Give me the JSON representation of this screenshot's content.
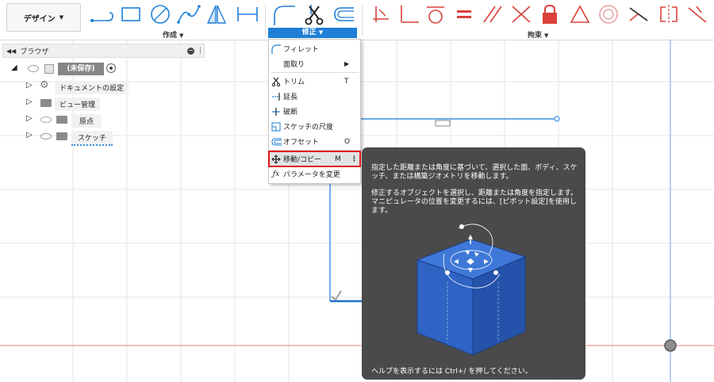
{
  "toolbar": {
    "design_label": "デザイン",
    "create_label": "作成",
    "modify_label": "修正",
    "constraints_label": "拘束"
  },
  "browser": {
    "title": "ブラウザ",
    "root_label": "(未保存)",
    "items": [
      {
        "label": "ドキュメントの設定"
      },
      {
        "label": "ビュー管理"
      },
      {
        "label": "原点"
      },
      {
        "label": "スケッチ"
      }
    ]
  },
  "modify_menu": {
    "items": [
      {
        "label": "フィレット",
        "shortcut": ""
      },
      {
        "label": "面取り",
        "shortcut": ""
      },
      {
        "label": "トリム",
        "shortcut": "T"
      },
      {
        "label": "延長",
        "shortcut": ""
      },
      {
        "label": "破断",
        "shortcut": ""
      },
      {
        "label": "スケッチの尺度",
        "shortcut": ""
      },
      {
        "label": "オフセット",
        "shortcut": "O"
      },
      {
        "label": "移動/コピー",
        "shortcut": "M"
      },
      {
        "label": "パラメータを変更",
        "shortcut": ""
      }
    ]
  },
  "tooltip": {
    "desc1": "指定した距離または角度に基づいて、選択した面、ボディ、スケッチ、または構築ジオメトリを移動します。",
    "desc2": "修正するオブジェクトを選択し、距離または角度を指定します。マニピュレータの位置を変更するには、[ピボット設定]を使用します。",
    "help_prefix": "ヘルプを表示するには ",
    "help_key": "Ctrl+/",
    "help_suffix": " を押してください。"
  },
  "colors": {
    "accent": "#1f7fd6",
    "axis_red": "#f08080",
    "axis_blue": "#6aa0e0",
    "sketch_line": "#3d8fe0",
    "highlight_border": "#e01818",
    "tooltip_bg": "#4a4a4a",
    "cube_blue": "#2f63c4",
    "constraint_red": "#d9413a"
  }
}
